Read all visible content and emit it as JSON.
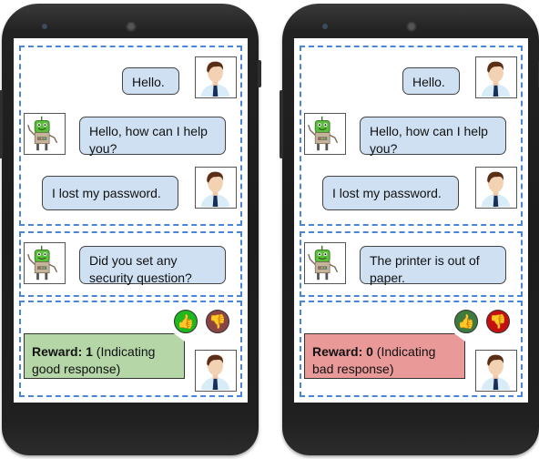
{
  "phones": [
    {
      "conversation": [
        {
          "speaker": "user",
          "avatar": "user-avatar-icon",
          "text": "Hello."
        },
        {
          "speaker": "bot",
          "avatar": "robot-avatar-icon",
          "text": "Hello, how can I help you?"
        },
        {
          "speaker": "user",
          "avatar": "user-avatar-icon",
          "text": "I  lost my password."
        }
      ],
      "bot_response": {
        "speaker": "bot",
        "avatar": "robot-avatar-icon",
        "text": "Did you set any security question?"
      },
      "feedback": {
        "thumbs_up": {
          "icon": "thumbs-up-icon",
          "state": "active",
          "color": "#1fb81f"
        },
        "thumbs_down": {
          "icon": "thumbs-down-icon",
          "state": "inactive",
          "color": "#8a4444"
        },
        "reward_label": "Reward: 1",
        "reward_note": " (Indicating good response)",
        "reward_color": "#b5d6a7"
      }
    },
    {
      "conversation": [
        {
          "speaker": "user",
          "avatar": "user-avatar-icon",
          "text": "Hello."
        },
        {
          "speaker": "bot",
          "avatar": "robot-avatar-icon",
          "text": "Hello, how can I help you?"
        },
        {
          "speaker": "user",
          "avatar": "user-avatar-icon",
          "text": "I  lost my password."
        }
      ],
      "bot_response": {
        "speaker": "bot",
        "avatar": "robot-avatar-icon",
        "text": "The printer is out of paper."
      },
      "feedback": {
        "thumbs_up": {
          "icon": "thumbs-up-icon",
          "state": "inactive",
          "color": "#3d7a3d"
        },
        "thumbs_down": {
          "icon": "thumbs-down-icon",
          "state": "active",
          "color": "#c41010"
        },
        "reward_label": "Reward: 0",
        "reward_note": " (Indicating bad response)",
        "reward_color": "#ea9999"
      }
    }
  ],
  "colors": {
    "bubble": "#cfe0f2",
    "dashed_border": "#4a86d8",
    "phone_body": "#1f1f1f"
  }
}
